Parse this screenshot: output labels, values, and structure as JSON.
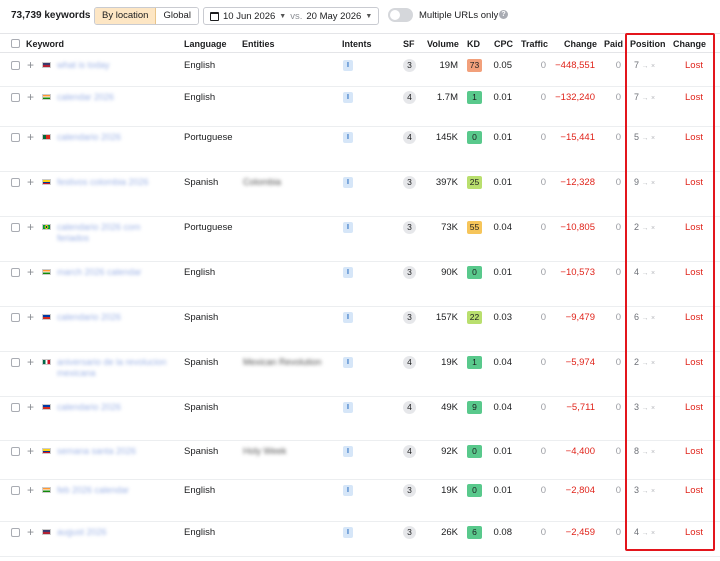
{
  "toolbar": {
    "keyword_count": "73,739 keywords",
    "by_location": "By location",
    "global": "Global",
    "date_from": "10 Jun 2026",
    "vs": "vs.",
    "date_to": "20 May 2026",
    "multiple_urls": "Multiple URLs only",
    "help": "?"
  },
  "columns": {
    "keyword": "Keyword",
    "language": "Language",
    "entities": "Entities",
    "intents": "Intents",
    "sf": "SF",
    "volume": "Volume",
    "kd": "KD",
    "cpc": "CPC",
    "traffic": "Traffic",
    "change": "Change",
    "paid": "Paid",
    "position": "Position",
    "position_change": "Change"
  },
  "rows": [
    {
      "flag": "us",
      "keyword": "what is today",
      "language": "English",
      "entity": "",
      "intent": "I",
      "sf": "3",
      "volume": "19M",
      "kd": "73",
      "kd_color": "#f2a07b",
      "cpc": "0.05",
      "traffic": "0",
      "change": "−448,551",
      "paid": "0",
      "position": "7",
      "arrow": "→",
      "new_position": "×",
      "status": "Lost"
    },
    {
      "flag": "in",
      "keyword": "calendar 2026",
      "language": "English",
      "entity": "",
      "intent": "I",
      "sf": "4",
      "volume": "1.7M",
      "kd": "1",
      "kd_color": "#59c98c",
      "cpc": "0.01",
      "traffic": "0",
      "change": "−132,240",
      "paid": "0",
      "position": "7",
      "arrow": "→",
      "new_position": "×",
      "status": "Lost"
    },
    {
      "flag": "pt",
      "keyword": "calendario 2026",
      "language": "Portuguese",
      "entity": "",
      "intent": "I",
      "sf": "4",
      "volume": "145K",
      "kd": "0",
      "kd_color": "#59c98c",
      "cpc": "0.01",
      "traffic": "0",
      "change": "−15,441",
      "paid": "0",
      "position": "5",
      "arrow": "→",
      "new_position": "×",
      "status": "Lost"
    },
    {
      "flag": "co",
      "keyword": "festivos colombia 2026",
      "language": "Spanish",
      "entity": "Colombia",
      "intent": "I",
      "sf": "3",
      "volume": "397K",
      "kd": "25",
      "kd_color": "#b9df6e",
      "cpc": "0.01",
      "traffic": "0",
      "change": "−12,328",
      "paid": "0",
      "position": "9",
      "arrow": "→",
      "new_position": "×",
      "status": "Lost"
    },
    {
      "flag": "br",
      "keyword": "calendario 2026 com feriados",
      "language": "Portuguese",
      "entity": "",
      "intent": "I",
      "sf": "3",
      "volume": "73K",
      "kd": "55",
      "kd_color": "#f6c55a",
      "cpc": "0.04",
      "traffic": "0",
      "change": "−10,805",
      "paid": "0",
      "position": "2",
      "arrow": "→",
      "new_position": "×",
      "status": "Lost"
    },
    {
      "flag": "in",
      "keyword": "march 2026 calendar",
      "language": "English",
      "entity": "",
      "intent": "I",
      "sf": "3",
      "volume": "90K",
      "kd": "0",
      "kd_color": "#59c98c",
      "cpc": "0.01",
      "traffic": "0",
      "change": "−10,573",
      "paid": "0",
      "position": "4",
      "arrow": "→",
      "new_position": "×",
      "status": "Lost"
    },
    {
      "flag": "cl",
      "keyword": "calendario 2026",
      "language": "Spanish",
      "entity": "",
      "intent": "I",
      "sf": "3",
      "volume": "157K",
      "kd": "22",
      "kd_color": "#b9df6e",
      "cpc": "0.03",
      "traffic": "0",
      "change": "−9,479",
      "paid": "0",
      "position": "6",
      "arrow": "→",
      "new_position": "×",
      "status": "Lost"
    },
    {
      "flag": "mx",
      "keyword": "aniversario de la revolucion mexicana",
      "language": "Spanish",
      "entity": "Mexican Revolution",
      "intent": "I",
      "sf": "4",
      "volume": "19K",
      "kd": "1",
      "kd_color": "#59c98c",
      "cpc": "0.04",
      "traffic": "0",
      "change": "−5,974",
      "paid": "0",
      "position": "2",
      "arrow": "→",
      "new_position": "×",
      "status": "Lost"
    },
    {
      "flag": "cl",
      "keyword": "calendario 2026",
      "language": "Spanish",
      "entity": "",
      "intent": "I",
      "sf": "4",
      "volume": "49K",
      "kd": "9",
      "kd_color": "#59c98c",
      "cpc": "0.04",
      "traffic": "0",
      "change": "−5,711",
      "paid": "0",
      "position": "3",
      "arrow": "→",
      "new_position": "×",
      "status": "Lost"
    },
    {
      "flag": "co",
      "keyword": "semana santa 2026",
      "language": "Spanish",
      "entity": "Holy Week",
      "intent": "I",
      "sf": "4",
      "volume": "92K",
      "kd": "0",
      "kd_color": "#59c98c",
      "cpc": "0.01",
      "traffic": "0",
      "change": "−4,400",
      "paid": "0",
      "position": "8",
      "arrow": "→",
      "new_position": "×",
      "status": "Lost"
    },
    {
      "flag": "in",
      "keyword": "feb 2026 calendar",
      "language": "English",
      "entity": "",
      "intent": "I",
      "sf": "3",
      "volume": "19K",
      "kd": "0",
      "kd_color": "#59c98c",
      "cpc": "0.01",
      "traffic": "0",
      "change": "−2,804",
      "paid": "0",
      "position": "3",
      "arrow": "→",
      "new_position": "×",
      "status": "Lost"
    },
    {
      "flag": "us",
      "keyword": "august 2026",
      "language": "English",
      "entity": "",
      "intent": "I",
      "sf": "3",
      "volume": "26K",
      "kd": "6",
      "kd_color": "#59c98c",
      "cpc": "0.08",
      "traffic": "0",
      "change": "−2,459",
      "paid": "0",
      "position": "4",
      "arrow": "→",
      "new_position": "×",
      "status": "Lost"
    }
  ]
}
